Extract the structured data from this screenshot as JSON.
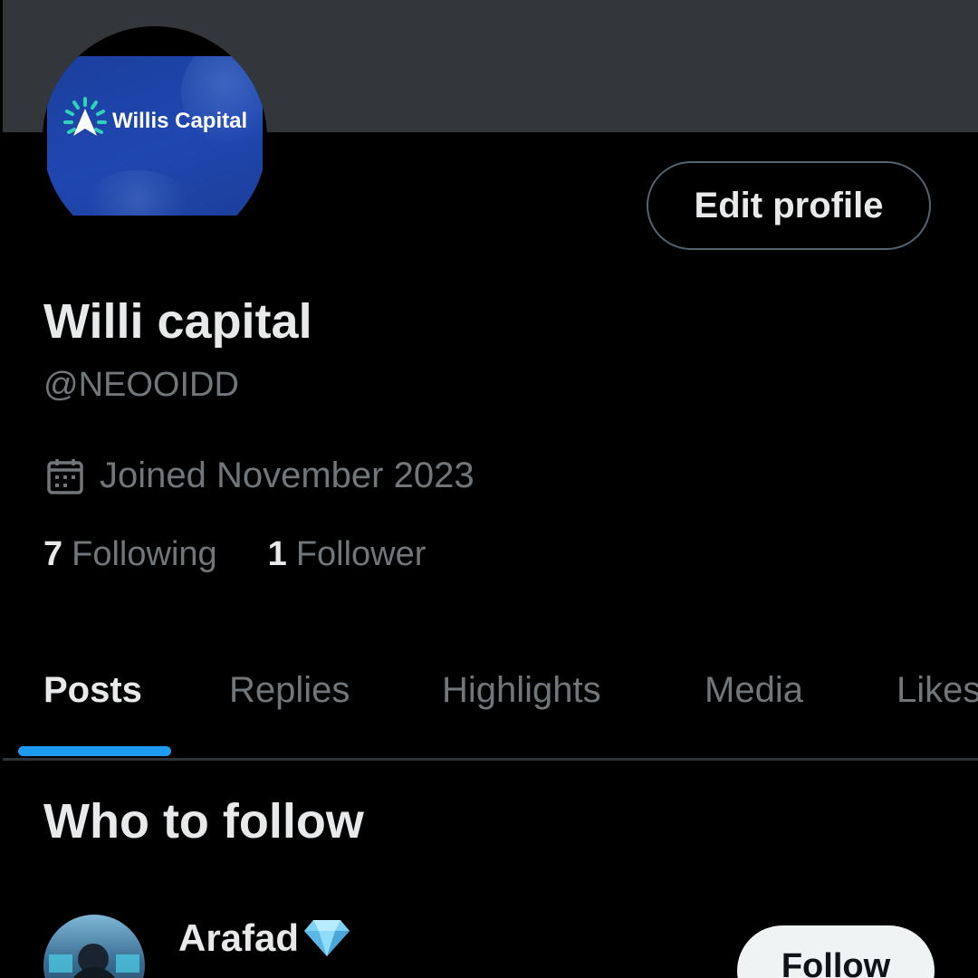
{
  "profile": {
    "avatar_logo_text": "Willis Capital",
    "edit_profile_label": "Edit profile",
    "display_name": "Willi capital",
    "handle": "@NEOOIDD",
    "joined": "Joined November 2023",
    "following_count": "7",
    "following_label": "Following",
    "followers_count": "1",
    "followers_label": "Follower"
  },
  "tabs": [
    {
      "label": "Posts",
      "active": true
    },
    {
      "label": "Replies",
      "active": false
    },
    {
      "label": "Highlights",
      "active": false
    },
    {
      "label": "Media",
      "active": false
    },
    {
      "label": "Likes",
      "active": false
    }
  ],
  "who_to_follow": {
    "title": "Who to follow",
    "items": [
      {
        "name": "Arafad",
        "badge_icon": "diamond-icon",
        "follow_label": "Follow"
      }
    ]
  },
  "colors": {
    "background": "#000000",
    "banner": "#33363a",
    "accent": "#1d9bf0",
    "primary_text": "#e7e9ea",
    "secondary_text": "#71767b",
    "avatar_blue": "#1f47b0"
  }
}
